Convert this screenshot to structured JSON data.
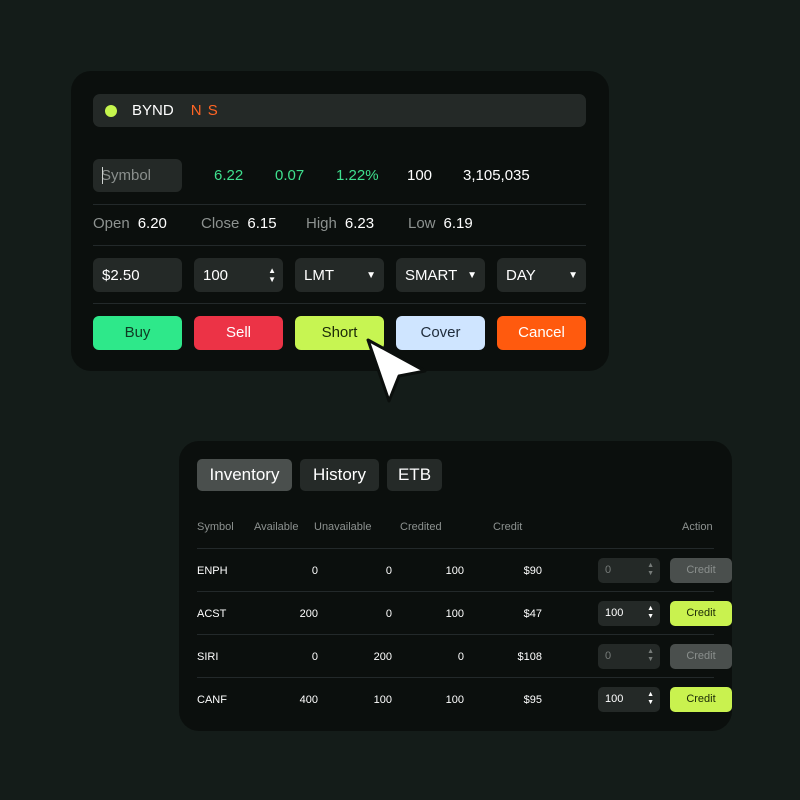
{
  "order_panel": {
    "ticker": {
      "symbol": "BYND",
      "flags": "N S"
    },
    "quote": {
      "symbol_placeholder": "Symbol",
      "last": "6.22",
      "change": "0.07",
      "change_pct": "1.22%",
      "size": "100",
      "volume": "3,105,035"
    },
    "ohlc": {
      "open_label": "Open",
      "open": "6.20",
      "close_label": "Close",
      "close": "6.15",
      "high_label": "High",
      "high": "6.23",
      "low_label": "Low",
      "low": "6.19"
    },
    "params": {
      "price": "$2.50",
      "quantity": "100",
      "order_type": "LMT",
      "route": "SMART",
      "tif": "DAY"
    },
    "actions": {
      "buy": "Buy",
      "sell": "Sell",
      "short": "Short",
      "cover": "Cover",
      "cancel": "Cancel"
    }
  },
  "inventory_panel": {
    "tabs": [
      {
        "label": "Inventory",
        "active": true
      },
      {
        "label": "History",
        "active": false
      },
      {
        "label": "ETB",
        "active": false
      }
    ],
    "columns": {
      "symbol": "Symbol",
      "available": "Available",
      "unavailable": "Unavailable",
      "credited": "Credited",
      "credit": "Credit",
      "action": "Action"
    },
    "rows": [
      {
        "symbol": "ENPH",
        "available": "0",
        "unavailable": "0",
        "credited": "100",
        "credit": "$90",
        "qty": "0",
        "action": "Credit",
        "enabled": false
      },
      {
        "symbol": "ACST",
        "available": "200",
        "unavailable": "0",
        "credited": "100",
        "credit": "$47",
        "qty": "100",
        "action": "Credit",
        "enabled": true
      },
      {
        "symbol": "SIRI",
        "available": "0",
        "unavailable": "200",
        "credited": "0",
        "credit": "$108",
        "qty": "0",
        "action": "Credit",
        "enabled": false
      },
      {
        "symbol": "CANF",
        "available": "400",
        "unavailable": "100",
        "credited": "100",
        "credit": "$95",
        "qty": "100",
        "action": "Credit",
        "enabled": true
      }
    ]
  },
  "colors": {
    "background": "#141c19",
    "panel": "#0b0f0d",
    "field": "#242927",
    "buy": "#2ee88a",
    "sell": "#ec3346",
    "short": "#c7f552",
    "cover": "#cfe5ff",
    "cancel": "#ff5a0e",
    "positive": "#3fe08e",
    "flag": "#ff6524"
  },
  "icons": {
    "status": "status-dot",
    "cursor": "mouse-pointer-icon"
  }
}
